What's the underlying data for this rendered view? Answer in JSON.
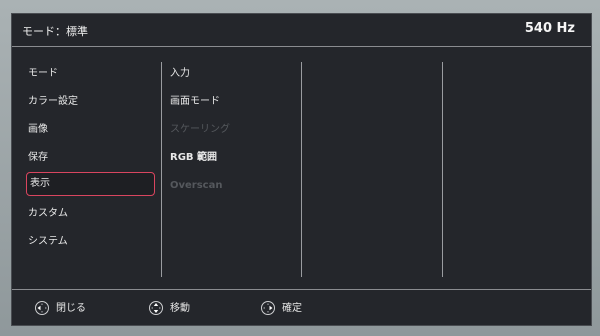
{
  "header": {
    "title": "モード：標準",
    "refresh_rate": "540 Hz"
  },
  "main_menu": {
    "items": [
      {
        "label": "モード"
      },
      {
        "label": "カラー設定"
      },
      {
        "label": "画像"
      },
      {
        "label": "保存"
      },
      {
        "label": "表示",
        "selected": true
      },
      {
        "label": "カスタム"
      },
      {
        "label": "システム"
      }
    ]
  },
  "submenu": {
    "items": [
      {
        "label": "入力",
        "enabled": true
      },
      {
        "label": "画面モード",
        "enabled": true
      },
      {
        "label": "スケーリング",
        "enabled": false
      },
      {
        "label": "RGB 範囲",
        "enabled": true
      },
      {
        "label": "Overscan",
        "enabled": false
      }
    ]
  },
  "footer": {
    "hints": [
      {
        "icon": "dpad-left-icon",
        "label": "閉じる"
      },
      {
        "icon": "dpad-updown-icon",
        "label": "移動"
      },
      {
        "icon": "dpad-right-icon",
        "label": "確定"
      }
    ]
  },
  "colors": {
    "osd_background": "#24262b",
    "selection_border": "#d9455f",
    "text": "#e8e8e8",
    "disabled_text": "#55585d"
  }
}
